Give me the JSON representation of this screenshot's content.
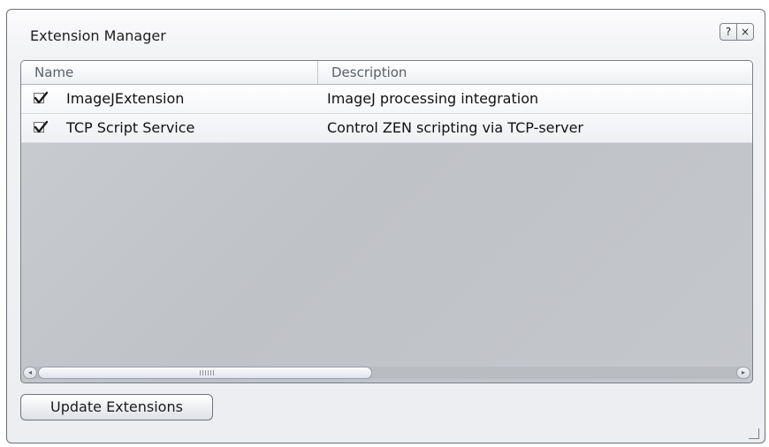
{
  "window": {
    "title": "Extension Manager",
    "help_label": "?",
    "close_label": "×"
  },
  "table": {
    "columns": [
      "Name",
      "Description"
    ],
    "rows": [
      {
        "name": "ImageJExtension",
        "description": "ImageJ processing integration",
        "checked": true
      },
      {
        "name": "TCP Script Service",
        "description": "Control ZEN scripting via TCP-server",
        "checked": true
      }
    ]
  },
  "scrollbar": {
    "left_arrow": "◂",
    "right_arrow": "▸"
  },
  "footer": {
    "update_label": "Update Extensions"
  },
  "icons": {
    "help": "question-icon",
    "close": "close-icon",
    "check": "checkmark-icon",
    "resize": "resize-grip-icon"
  }
}
